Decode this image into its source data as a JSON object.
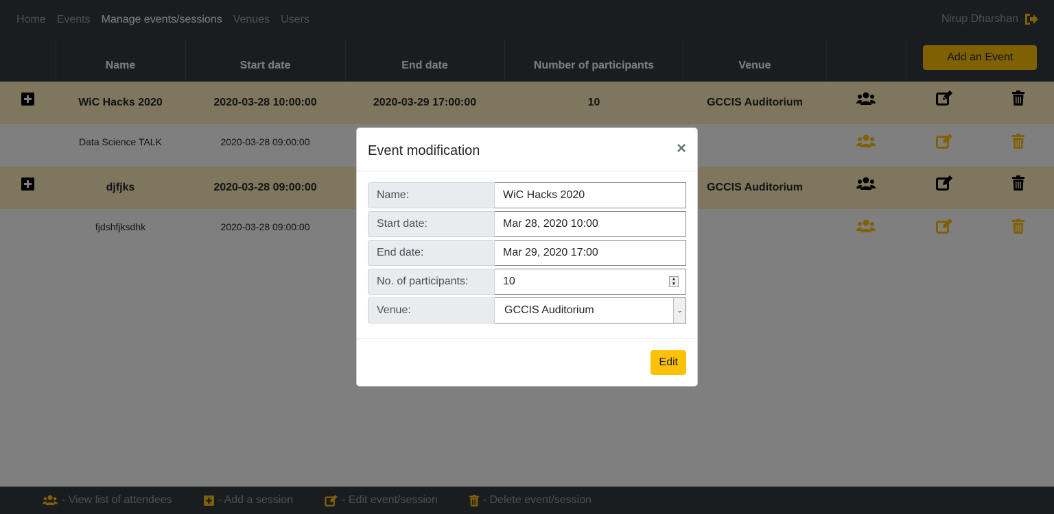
{
  "nav": {
    "links": [
      "Home",
      "Events",
      "Manage events/sessions",
      "Venues",
      "Users"
    ],
    "active_index": 2,
    "user_name": "Nirup Dharshan"
  },
  "table": {
    "headers": [
      "",
      "Name",
      "Start date",
      "End date",
      "Number of participants",
      "Venue",
      "",
      "",
      ""
    ],
    "add_event_label": "Add an Event",
    "rows": [
      {
        "type": "event",
        "name": "WiC Hacks 2020",
        "start": "2020-03-28 10:00:00",
        "end": "2020-03-29 17:00:00",
        "participants": "10",
        "venue": "GCCIS Auditorium"
      },
      {
        "type": "session",
        "name": "Data Science TALK",
        "start": "2020-03-28 09:00:00",
        "end": "",
        "participants": "",
        "venue": ""
      },
      {
        "type": "event",
        "name": "djfjks",
        "start": "2020-03-28 09:00:00",
        "end": "",
        "participants": "",
        "venue": "GCCIS Auditorium"
      },
      {
        "type": "session",
        "name": "fjdshfjksdhk",
        "start": "2020-03-28 09:00:00",
        "end": "",
        "participants": "",
        "venue": ""
      }
    ]
  },
  "legend": {
    "attendees": "- View list of attendees",
    "add_session": "- Add a session",
    "edit": "- Edit event/session",
    "delete": "- Delete event/session"
  },
  "modal": {
    "title": "Event modification",
    "close": "×",
    "fields": {
      "name_label": "Name:",
      "name_value": "WiC Hacks 2020",
      "start_label": "Start date:",
      "start_value": "Mar 28, 2020 10:00",
      "end_label": "End date:",
      "end_value": "Mar 29, 2020 17:00",
      "participants_label": "No. of participants:",
      "participants_value": "10",
      "venue_label": "Venue:",
      "venue_value": "GCCIS Auditorium"
    },
    "submit_label": "Edit"
  },
  "colors": {
    "dark": "#343a40",
    "warning": "#ffc107",
    "event_row": "#ffeeba"
  }
}
